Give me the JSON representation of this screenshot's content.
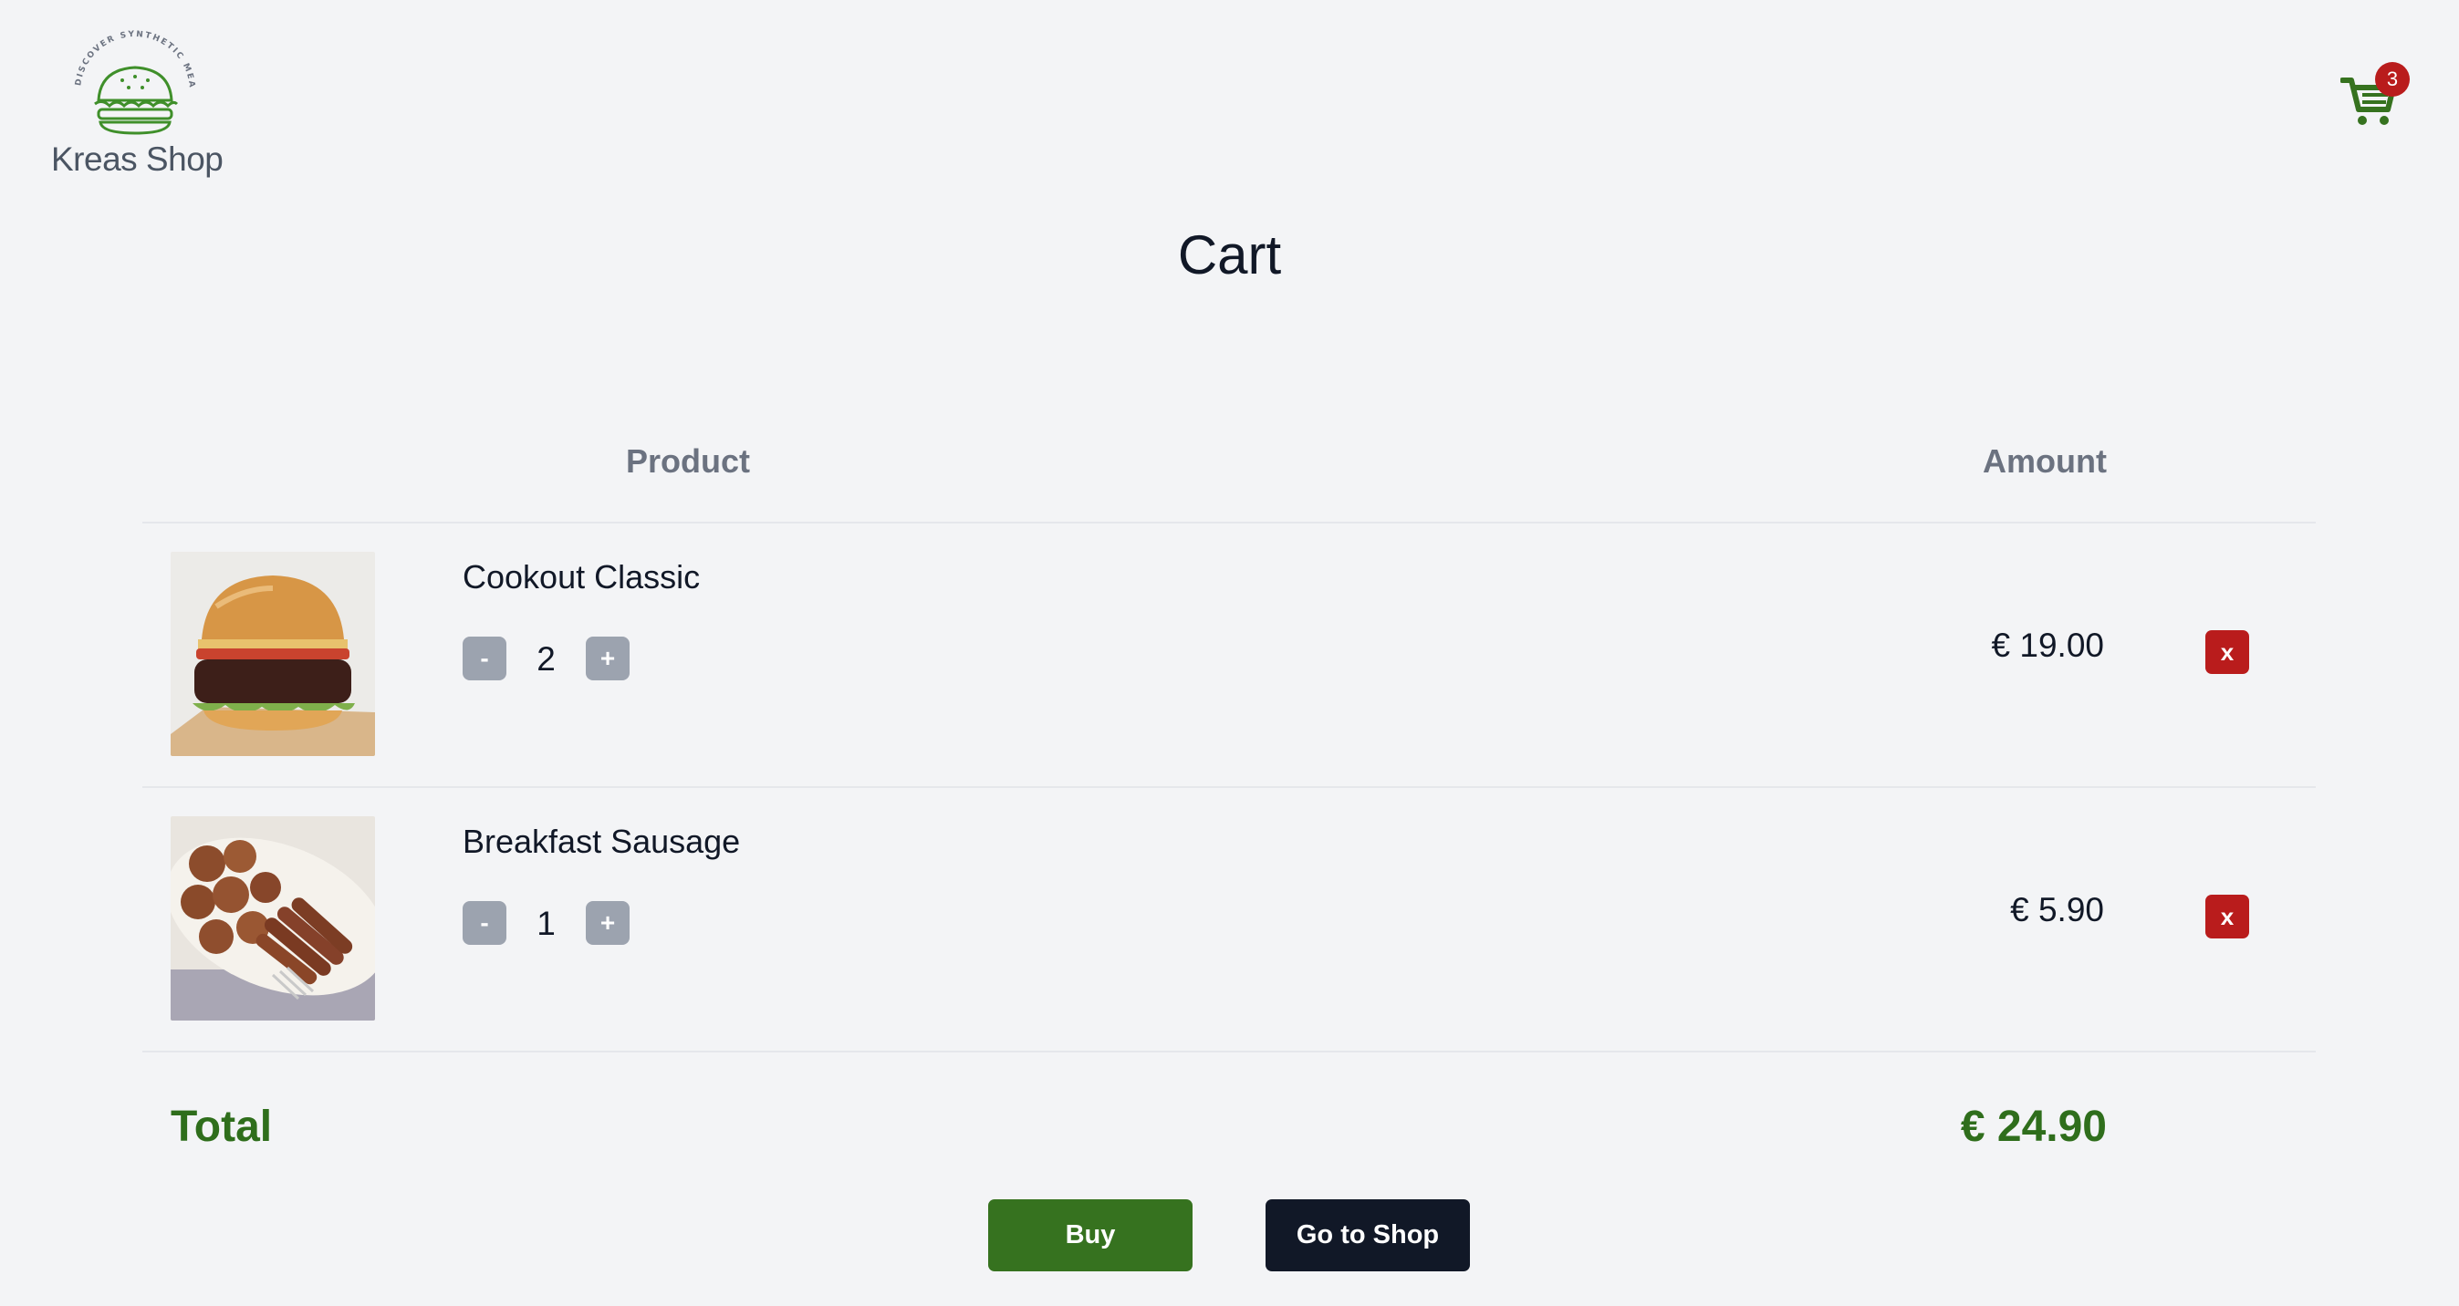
{
  "brand": {
    "name": "Kreas Shop",
    "tagline": "DISCOVER SYNTHETIC MEAT",
    "logo_color": "#3f8f2a"
  },
  "header": {
    "cart_icon": "cart-icon",
    "cart_count": "3"
  },
  "page": {
    "title": "Cart"
  },
  "table": {
    "columns": {
      "product": "Product",
      "amount": "Amount"
    },
    "items": [
      {
        "name": "Cookout Classic",
        "image": "burger-image",
        "quantity": "2",
        "decrement_label": "-",
        "increment_label": "+",
        "amount": "€ 19.00",
        "remove_label": "x"
      },
      {
        "name": "Breakfast Sausage",
        "image": "sausage-image",
        "quantity": "1",
        "decrement_label": "-",
        "increment_label": "+",
        "amount": "€ 5.90",
        "remove_label": "x"
      }
    ]
  },
  "summary": {
    "total_label": "Total",
    "total_value": "€ 24.90"
  },
  "actions": {
    "buy_label": "Buy",
    "shop_label": "Go to Shop"
  },
  "colors": {
    "background": "#f3f4f6",
    "accent_green": "#36721f",
    "danger_red": "#b91c1c",
    "dark_button": "#111827",
    "muted_gray": "#9ca3af"
  }
}
